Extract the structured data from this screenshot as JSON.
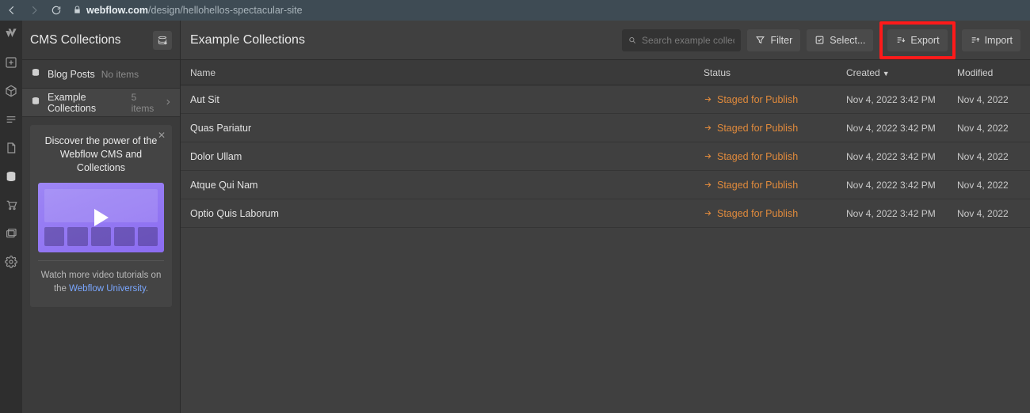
{
  "browser": {
    "url_domain": "webflow.com",
    "url_path": "/design/hellohellos-spectacular-site"
  },
  "panel": {
    "title": "CMS Collections",
    "collections": [
      {
        "label": "Blog Posts",
        "count": "No items"
      },
      {
        "label": "Example Collections",
        "count": "5 items"
      }
    ]
  },
  "promo": {
    "heading": "Discover the power of the Webflow CMS and Collections",
    "caption_prefix": "Watch more video tutorials on the ",
    "caption_link": "Webflow University",
    "caption_suffix": "."
  },
  "main": {
    "title": "Example Collections",
    "search_placeholder": "Search example collections",
    "buttons": {
      "filter": "Filter",
      "select": "Select...",
      "export": "Export",
      "import": "Import"
    },
    "columns": {
      "name": "Name",
      "status": "Status",
      "created": "Created",
      "modified": "Modified"
    },
    "rows": [
      {
        "name": "Aut Sit",
        "status": "Staged for Publish",
        "created": "Nov 4, 2022 3:42 PM",
        "modified": "Nov 4, 2022"
      },
      {
        "name": "Quas Pariatur",
        "status": "Staged for Publish",
        "created": "Nov 4, 2022 3:42 PM",
        "modified": "Nov 4, 2022"
      },
      {
        "name": "Dolor Ullam",
        "status": "Staged for Publish",
        "created": "Nov 4, 2022 3:42 PM",
        "modified": "Nov 4, 2022"
      },
      {
        "name": "Atque Qui Nam",
        "status": "Staged for Publish",
        "created": "Nov 4, 2022 3:42 PM",
        "modified": "Nov 4, 2022"
      },
      {
        "name": "Optio Quis Laborum",
        "status": "Staged for Publish",
        "created": "Nov 4, 2022 3:42 PM",
        "modified": "Nov 4, 2022"
      }
    ]
  }
}
